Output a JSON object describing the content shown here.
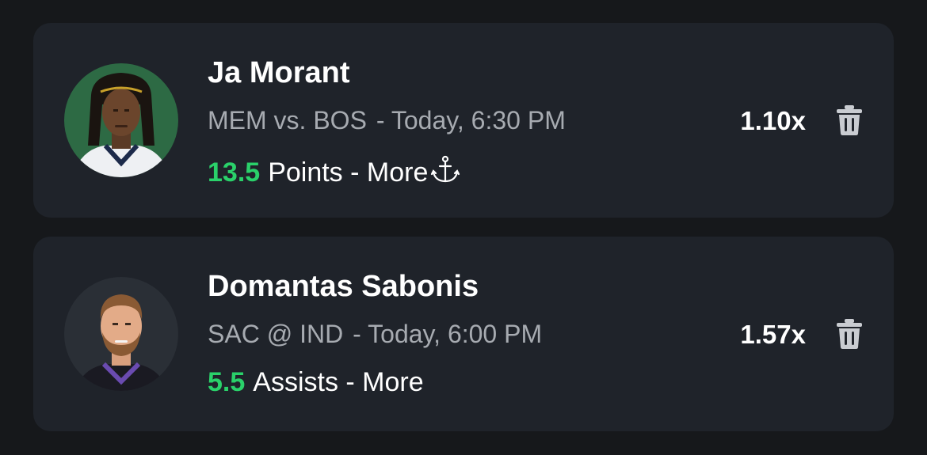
{
  "picks": [
    {
      "player_name": "Ja Morant",
      "matchup": "MEM vs. BOS",
      "game_time": "- Today, 6:30 PM",
      "line_value": "13.5",
      "stat_text": "Points - More",
      "multiplier": "1.10x",
      "has_anchor": true,
      "avatar_bg": "#2d6a44"
    },
    {
      "player_name": "Domantas Sabonis",
      "matchup": "SAC @ IND",
      "game_time": "- Today, 6:00 PM",
      "line_value": "5.5",
      "stat_text": "Assists - More",
      "multiplier": "1.57x",
      "has_anchor": false,
      "avatar_bg": "#2a2f36"
    }
  ],
  "colors": {
    "background": "#16181b",
    "card": "#1f232a",
    "accent_green": "#2ad16a",
    "muted_text": "#a7abb1"
  },
  "icons": {
    "delete": "trash-icon",
    "anchor": "anchor-icon"
  }
}
